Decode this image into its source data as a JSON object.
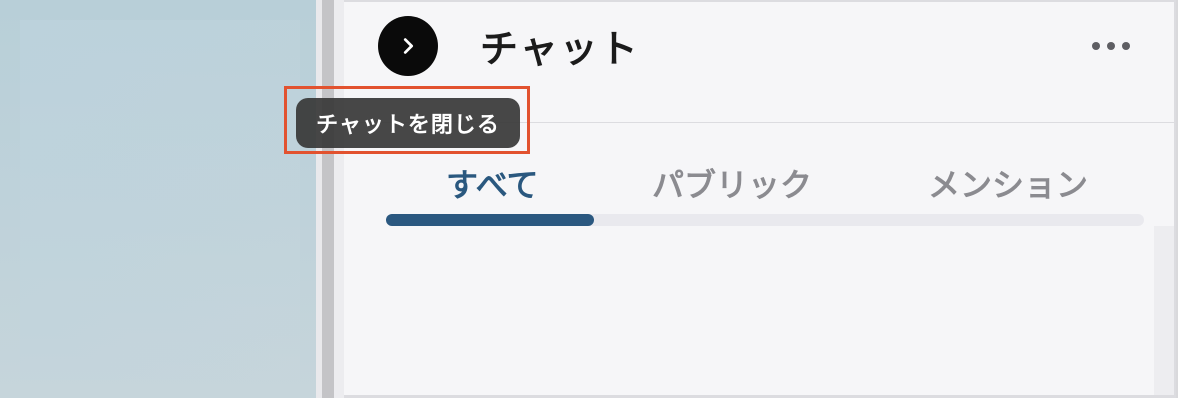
{
  "header": {
    "title": "チャット",
    "collapse_icon": "chevron-right-icon",
    "more_icon": "more-horizontal-icon"
  },
  "tooltip": {
    "text": "チャットを閉じる"
  },
  "tabs": [
    {
      "label": "すべて",
      "active": true
    },
    {
      "label": "パブリック",
      "active": false
    },
    {
      "label": "メンション",
      "active": false
    }
  ],
  "colors": {
    "accent": "#2a587f",
    "highlight": "#e2522f",
    "tooltip_bg": "#373737"
  }
}
